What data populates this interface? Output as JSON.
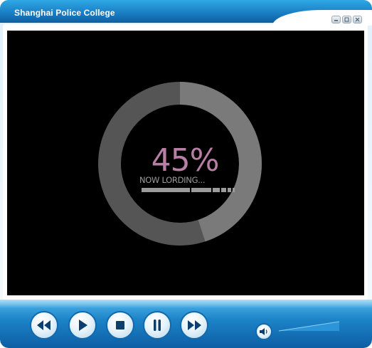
{
  "window": {
    "title": "Shanghai Police College",
    "buttons": [
      "minimize",
      "maximize",
      "close"
    ]
  },
  "player": {
    "loading": {
      "percent_label": "45%",
      "status_text": "NOW LORDING...",
      "progress": 0.45
    },
    "controls": [
      {
        "name": "rewind",
        "icon": "rewind-icon"
      },
      {
        "name": "play",
        "icon": "play-icon"
      },
      {
        "name": "stop",
        "icon": "stop-icon"
      },
      {
        "name": "pause",
        "icon": "pause-icon"
      },
      {
        "name": "fast-forward",
        "icon": "fast-forward-icon"
      }
    ],
    "volume": {
      "icon": "speaker-icon"
    }
  },
  "colors": {
    "title_bar": "#1b7fc4",
    "screen": "#000000",
    "ring_fill": "#7a7a7a",
    "ring_track": "#555555",
    "percent_text": "#b87fa6",
    "control_bar": "#1d84c8"
  }
}
